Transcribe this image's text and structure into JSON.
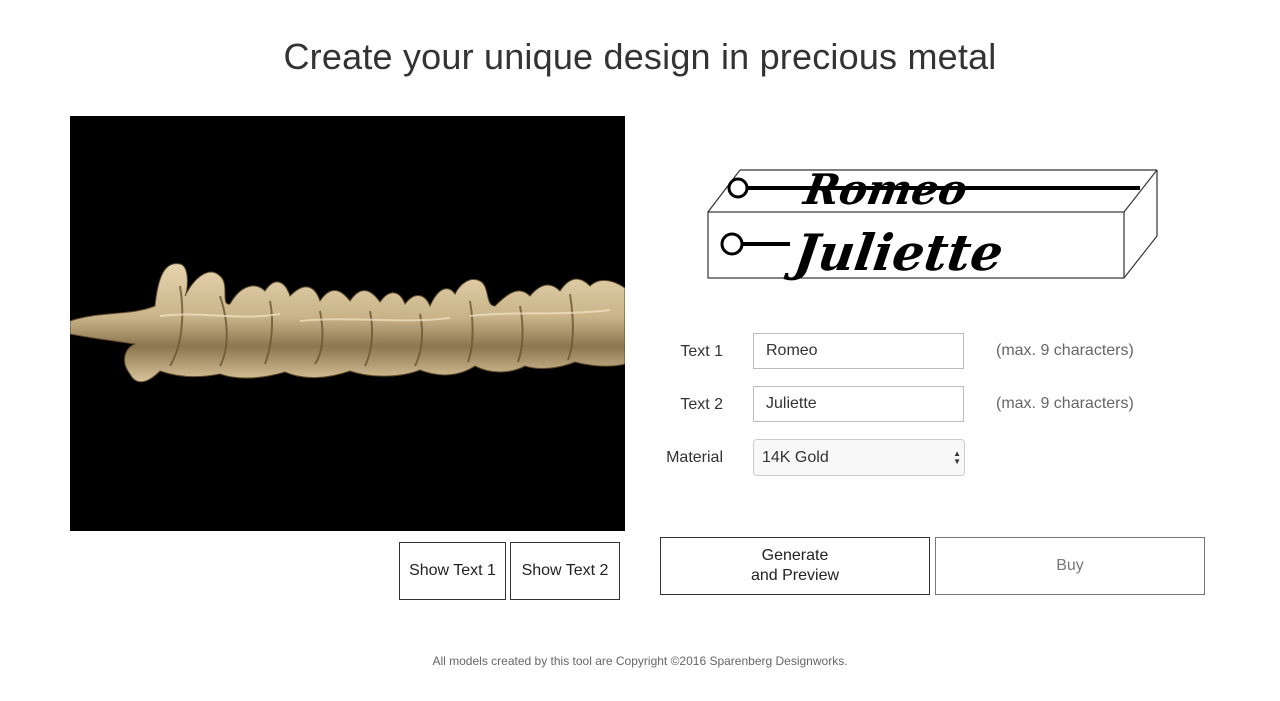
{
  "page": {
    "title": "Create your unique design in precious metal",
    "footer": "All models created by this tool are Copyright ©2016 Sparenberg Designworks."
  },
  "preview": {
    "line1": "Romeo",
    "line2": "Juliette"
  },
  "form": {
    "text1_label": "Text 1",
    "text1_value": "Romeo",
    "text1_hint": "(max. 9 characters)",
    "text2_label": "Text 2",
    "text2_value": "Juliette",
    "text2_hint": "(max. 9 characters)",
    "material_label": "Material",
    "material_value": "14K Gold"
  },
  "buttons": {
    "show_text1": "Show Text 1",
    "show_text2": "Show Text 2",
    "generate_line1": "Generate",
    "generate_line2": "and Preview",
    "buy": "Buy"
  },
  "colors": {
    "gold": "#c9b48a",
    "viewer_bg": "#000000"
  },
  "icons": {
    "select_arrows": "up-down-arrows-icon"
  }
}
